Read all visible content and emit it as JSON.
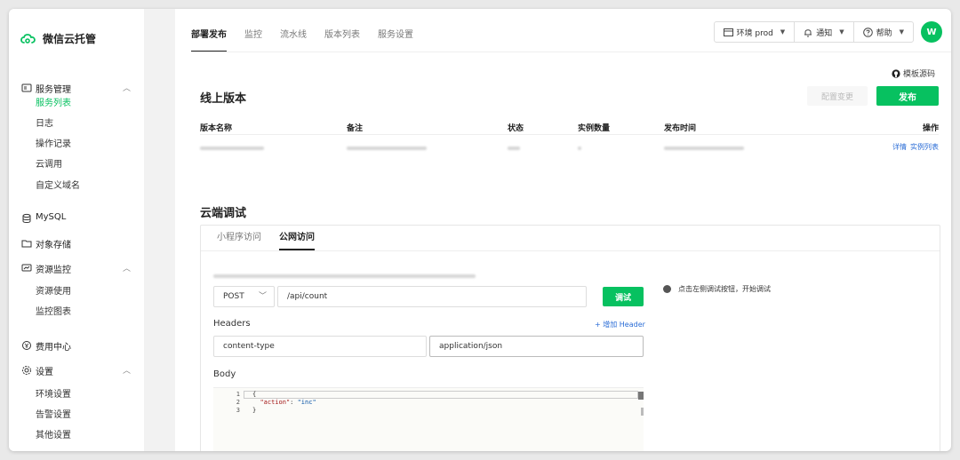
{
  "app": {
    "title": "微信云托管",
    "brand_color": "#07c160"
  },
  "sidebar": {
    "groups": [
      {
        "label": "服务管理",
        "icon": "server-icon",
        "expanded": true,
        "items": [
          "服务列表",
          "日志",
          "操作记录",
          "云调用",
          "自定义域名"
        ]
      },
      {
        "label": "MySQL",
        "icon": "database-icon"
      },
      {
        "label": "对象存储",
        "icon": "folder-icon"
      },
      {
        "label": "资源监控",
        "icon": "monitor-icon",
        "expanded": true,
        "items": [
          "资源使用",
          "监控图表"
        ]
      },
      {
        "label": "费用中心",
        "icon": "coin-icon"
      },
      {
        "label": "设置",
        "icon": "gear-icon",
        "expanded": true,
        "items": [
          "环境设置",
          "告警设置",
          "其他设置"
        ]
      }
    ],
    "active_item": "服务列表"
  },
  "tabs": [
    "部署发布",
    "监控",
    "流水线",
    "版本列表",
    "服务设置"
  ],
  "active_tab": "部署发布",
  "topbar": {
    "env": "环境 prod",
    "notify": "通知",
    "help": "帮助",
    "avatar_initial": "W"
  },
  "online": {
    "title": "线上版本",
    "source_link": "模板源码",
    "config_btn": "配置变更",
    "publish_btn": "发布",
    "columns": [
      "版本名称",
      "备注",
      "状态",
      "实例数量",
      "发布时间",
      "操作"
    ],
    "row_ops": [
      "详情",
      "实例列表"
    ]
  },
  "debug": {
    "title": "云端调试",
    "subtabs": [
      "小程序访问",
      "公网访问"
    ],
    "active_subtab": "公网访问",
    "method": "POST",
    "path": "/api/count",
    "try_btn": "调试",
    "hint": "点击左侧调试按钮，开始调试",
    "headers_label": "Headers",
    "add_header": "+ 增加 Header",
    "header_key": "content-type",
    "header_value": "application/json",
    "body_label": "Body",
    "body_lines": [
      "1",
      "2",
      "3"
    ]
  }
}
